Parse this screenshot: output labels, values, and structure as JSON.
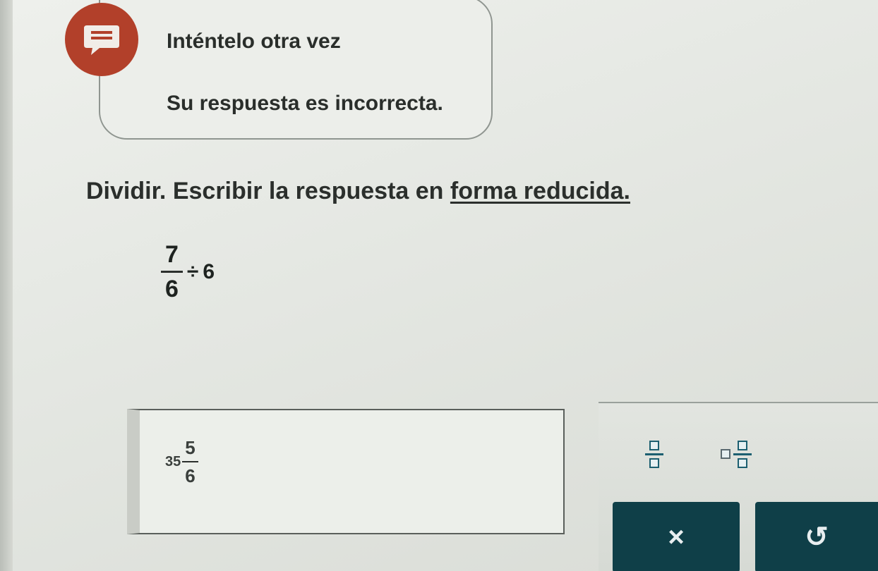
{
  "feedback": {
    "title": "Inténtelo otra vez",
    "message": "Su respuesta es incorrecta.",
    "icon": "chat-bubble-icon",
    "icon_color": "#b2402a"
  },
  "instruction": {
    "text": "Dividir. Escribir la respuesta en ",
    "link": "forma reducida."
  },
  "problem": {
    "numerator": "7",
    "denominator": "6",
    "operator": "÷",
    "divisor": "6"
  },
  "answer": {
    "whole": "35",
    "numerator": "5",
    "denominator": "6"
  },
  "keypad": {
    "fraction_template": "fraction-template-icon",
    "mixed_template": "mixed-number-template-icon",
    "clear_label": "×",
    "undo_label": "↺",
    "action_color": "#0f3f48"
  }
}
